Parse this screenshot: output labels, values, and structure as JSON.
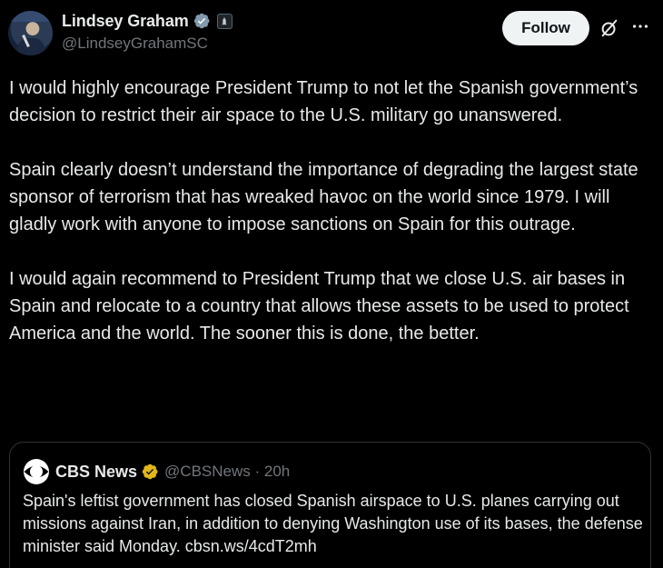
{
  "author": {
    "display_name": "Lindsey Graham",
    "handle": "@LindseyGrahamSC",
    "verified_color": "#829aab",
    "avatar_icon": "profile-photo"
  },
  "actions": {
    "follow_label": "Follow",
    "grok_icon": "grok-icon",
    "more_icon": "more-icon"
  },
  "tweet": {
    "paragraphs": [
      "I would highly encourage President Trump to not let the Spanish government’s decision to restrict their air space to the U.S. military go unanswered.",
      "Spain clearly doesn’t understand the importance of degrading the largest state sponsor of terrorism that has wreaked havoc on the world since 1979. I will gladly work with anyone to impose sanctions on Spain for this outrage.",
      "I would again recommend to President Trump that we close U.S. air bases in Spain and relocate to a country that allows these assets to be used to protect America and the world. The sooner this is done, the better."
    ]
  },
  "quote": {
    "display_name": "CBS News",
    "handle_time": "@CBSNews · 20h",
    "text": "Spain's leftist government has closed Spanish airspace to U.S. planes carrying out missions against Iran, in addition to denying Washington use of its bases, the defense minister said Monday. cbsn.ws/4cdT2mh",
    "badge_color": "#e2b719",
    "logo_icon": "cbs-eye-icon"
  },
  "colors": {
    "background": "#000000",
    "text": "#e7e9ea",
    "muted": "#71767b",
    "border": "#2f3336"
  }
}
